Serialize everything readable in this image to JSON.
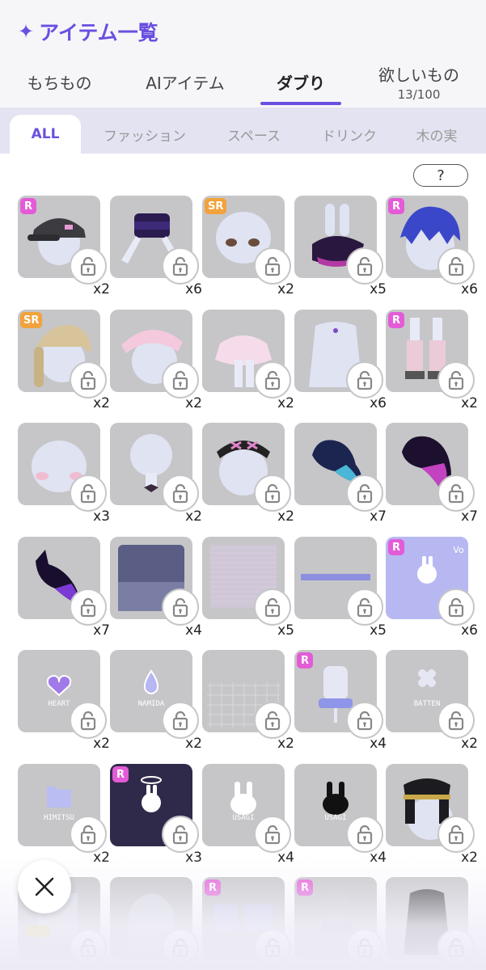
{
  "header": {
    "title": "アイテム一覧",
    "title_icon": "sparkle-icon",
    "tabs": [
      {
        "label": "もちもの",
        "sub": ""
      },
      {
        "label": "AIアイテム",
        "sub": ""
      },
      {
        "label": "ダブり",
        "sub": ""
      },
      {
        "label": "欲しいもの",
        "sub": "13/100"
      }
    ],
    "active_tab": "ダブり"
  },
  "categories": [
    "ALL",
    "ファッション",
    "スペース",
    "ドリンク",
    "木の実"
  ],
  "active_category": "ALL",
  "help_label": "?",
  "colors": {
    "accent": "#6b4fe0",
    "tile": "#c6c6c9",
    "badge_r": "#e35bd6",
    "badge_sr": "#f2a23c"
  },
  "items": [
    {
      "rarity": "R",
      "count": "x2",
      "icon": "black-cap-icon",
      "text": ""
    },
    {
      "rarity": "",
      "count": "x6",
      "icon": "dark-top-icon",
      "text": ""
    },
    {
      "rarity": "SR",
      "count": "x2",
      "icon": "eyes-face-icon",
      "text": ""
    },
    {
      "rarity": "",
      "count": "x5",
      "icon": "bunny-ears-hat-icon",
      "text": ""
    },
    {
      "rarity": "R",
      "count": "x6",
      "icon": "blue-hair-icon",
      "text": ""
    },
    {
      "rarity": "SR",
      "count": "x2",
      "icon": "blonde-braid-hair-icon",
      "text": ""
    },
    {
      "rarity": "",
      "count": "x2",
      "icon": "pink-braid-hair-icon",
      "text": ""
    },
    {
      "rarity": "",
      "count": "x2",
      "icon": "pink-skirt-icon",
      "text": ""
    },
    {
      "rarity": "",
      "count": "x6",
      "icon": "choker-dress-icon",
      "text": ""
    },
    {
      "rarity": "R",
      "count": "x2",
      "icon": "plaid-boots-icon",
      "text": ""
    },
    {
      "rarity": "",
      "count": "x3",
      "icon": "blush-face-icon",
      "text": ""
    },
    {
      "rarity": "",
      "count": "x2",
      "icon": "ribbon-neck-icon",
      "text": ""
    },
    {
      "rarity": "",
      "count": "x2",
      "icon": "black-headband-icon",
      "text": ""
    },
    {
      "rarity": "",
      "count": "x7",
      "icon": "blue-ghost-icon",
      "text": ""
    },
    {
      "rarity": "",
      "count": "x7",
      "icon": "purple-ghost-icon",
      "text": ""
    },
    {
      "rarity": "",
      "count": "x7",
      "icon": "bunny-ghost-icon",
      "text": ""
    },
    {
      "rarity": "",
      "count": "x4",
      "icon": "dark-room-icon",
      "text": ""
    },
    {
      "rarity": "",
      "count": "x5",
      "icon": "striped-wall-icon",
      "text": ""
    },
    {
      "rarity": "",
      "count": "x5",
      "icon": "banner-strip-icon",
      "text": ""
    },
    {
      "rarity": "R",
      "count": "x6",
      "icon": "bunny-poster-icon",
      "text": ""
    },
    {
      "rarity": "",
      "count": "x2",
      "icon": "heart-gem-icon",
      "text": "HEART"
    },
    {
      "rarity": "",
      "count": "x2",
      "icon": "teardrop-gem-icon",
      "text": "NAMIDA"
    },
    {
      "rarity": "",
      "count": "x2",
      "icon": "grid-floor-icon",
      "text": ""
    },
    {
      "rarity": "R",
      "count": "x4",
      "icon": "gaming-chair-icon",
      "text": ""
    },
    {
      "rarity": "",
      "count": "x2",
      "icon": "bandage-icon",
      "text": "BATTEN"
    },
    {
      "rarity": "",
      "count": "x2",
      "icon": "folder-icon",
      "text": "HIMITSU"
    },
    {
      "rarity": "R",
      "count": "x3",
      "icon": "angel-bunny-poster-icon",
      "text": ""
    },
    {
      "rarity": "",
      "count": "x4",
      "icon": "white-bunny-icon",
      "text": "USAGI"
    },
    {
      "rarity": "",
      "count": "x4",
      "icon": "black-bunny-icon",
      "text": "USAGI"
    },
    {
      "rarity": "",
      "count": "x2",
      "icon": "military-cap-icon",
      "text": ""
    },
    {
      "rarity": "",
      "count": "",
      "icon": "yellow-shoes-icon",
      "text": ""
    },
    {
      "rarity": "",
      "count": "",
      "icon": "hood-icon",
      "text": ""
    },
    {
      "rarity": "R",
      "count": "",
      "icon": "room-furniture-icon",
      "text": ""
    },
    {
      "rarity": "R",
      "count": "",
      "icon": "grey-chair-icon",
      "text": ""
    },
    {
      "rarity": "",
      "count": "",
      "icon": "dark-outfit-icon",
      "text": ""
    }
  ],
  "close_icon": "close-icon"
}
